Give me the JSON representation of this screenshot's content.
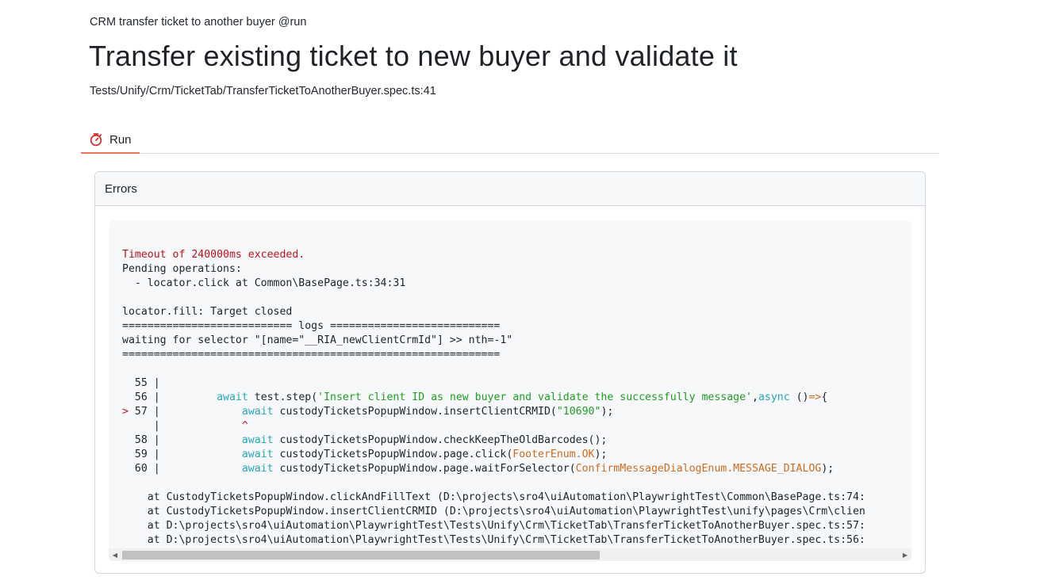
{
  "header": {
    "suite": "CRM transfer ticket to another buyer @run",
    "title": "Transfer existing ticket to new buyer and validate it",
    "path": "Tests/Unify/Crm/TicketTab/TransferTicketToAnotherBuyer.spec.ts:41"
  },
  "tabs": [
    {
      "label": "Run",
      "icon": "stopwatch-icon",
      "active": true
    }
  ],
  "errors_panel": {
    "title": "Errors",
    "lines": {
      "l1": "Timeout of 240000ms exceeded.",
      "l2": "Pending operations:",
      "l3": "  - locator.click at Common\\BasePage.ts:34:31",
      "l5": "locator.fill: Target closed",
      "l6": "=========================== logs ===========================",
      "l7": "waiting for selector \"[name=\"__RIA_newClientCrmId\"] >> nth=-1\"",
      "l8": "============================================================",
      "g55": "  55 |",
      "g56": "  56 |",
      "g57a": "> ",
      "g57b": "57 |",
      "gcaret": "     |",
      "g58": "  58 |",
      "g59": "  59 |",
      "g60": "  60 |",
      "c56_ind": "         ",
      "c56_kw": "await",
      "c56_a": " test.step(",
      "c56_str": "'Insert client ID as new buyer and validate the successfully message'",
      "c56_b": ",",
      "c56_kw2": "async",
      "c56_c": " ()",
      "c56_arrow": "=>",
      "c56_d": "{",
      "c57_ind": "             ",
      "c57_kw": "await",
      "c57_a": " custodyTicketsPopupWindow.insertClientCRMID(",
      "c57_str": "\"10690\"",
      "c57_b": ");",
      "caret_ind": "             ",
      "caret": "^",
      "c58_ind": "             ",
      "c58_kw": "await",
      "c58_a": " custodyTicketsPopupWindow.checkKeepTheOldBarcodes();",
      "c59_ind": "             ",
      "c59_kw": "await",
      "c59_a": " custodyTicketsPopupWindow.page.click(",
      "c59_enum": "FooterEnum.OK",
      "c59_b": ");",
      "c60_ind": "             ",
      "c60_kw": "await",
      "c60_a": " custodyTicketsPopupWindow.page.waitForSelector(",
      "c60_enum": "ConfirmMessageDialogEnum.MESSAGE_DIALOG",
      "c60_b": ");",
      "s1": "    at CustodyTicketsPopupWindow.clickAndFillText (D:\\projects\\sro4\\uiAutomation\\PlaywrightTest\\Common\\BasePage.ts:74:",
      "s2": "    at CustodyTicketsPopupWindow.insertClientCRMID (D:\\projects\\sro4\\uiAutomation\\PlaywrightTest\\unify\\pages\\Crm\\clien",
      "s3": "    at D:\\projects\\sro4\\uiAutomation\\PlaywrightTest\\Tests\\Unify\\Crm\\TicketTab\\TransferTicketToAnotherBuyer.spec.ts:57:",
      "s4": "    at D:\\projects\\sro4\\uiAutomation\\PlaywrightTest\\Tests\\Unify\\Crm\\TicketTab\\TransferTicketToAnotherBuyer.spec.ts:56:"
    }
  },
  "scrollbar": {
    "left_arrow": "◀",
    "right_arrow": "▶"
  },
  "colors": {
    "error_red": "#c50f1f",
    "keyword_cyan": "#23a8bf",
    "string_green": "#1f9e1f",
    "enum_orange": "#d16b1c",
    "tab_underline": "#f2765e"
  }
}
